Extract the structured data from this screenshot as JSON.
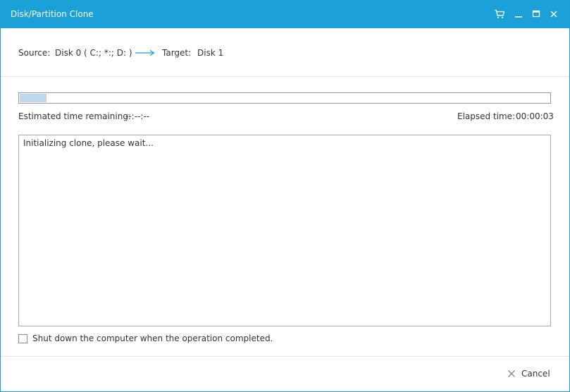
{
  "window": {
    "title": "Disk/Partition Clone"
  },
  "titlebar_icons": [
    "cart-icon",
    "minimize-icon",
    "maximize-icon",
    "close-icon"
  ],
  "header": {
    "source_label": "Source:",
    "source_value": "Disk 0 ( C:; *:; D: )",
    "target_label": "Target:",
    "target_value": "Disk 1"
  },
  "progress": {
    "percent": 5
  },
  "time": {
    "estimated_label": "Estimated time remaining:",
    "estimated_value": "--:--:--",
    "elapsed_label": "Elapsed time:",
    "elapsed_value": "00:00:03"
  },
  "log": {
    "lines": [
      "Initializing clone, please wait..."
    ]
  },
  "options": {
    "shutdown_label": "Shut down the computer when the operation completed.",
    "shutdown_checked": false
  },
  "footer": {
    "cancel_label": "Cancel"
  },
  "colors": {
    "titlebar": "#1ba1d8",
    "accent_arrow": "#1ba1d8",
    "progress_fill": "#bcd8f0"
  }
}
